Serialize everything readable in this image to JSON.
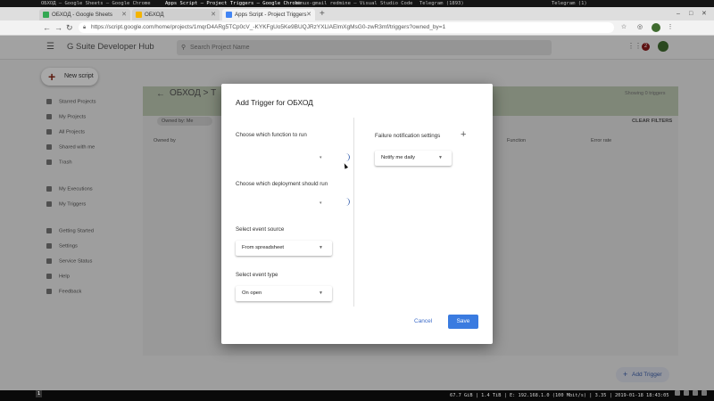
{
  "wm_bar": {
    "titles": [
      "ОБХОД – Google Sheets – Google Chrome",
      "Apps Script – Project Triggers – Google Chrome",
      "linux-gmail redmine – Visual Studio Code",
      "Telegram (1893)",
      "Telegram (1)"
    ],
    "active_index": 1
  },
  "tabs": [
    {
      "label": "ОБХОД - Google Sheets",
      "color": "#34a853"
    },
    {
      "label": "ОБХОД",
      "color": "#f4b400"
    },
    {
      "label": "Apps Script - Project Triggers",
      "color": "#4285f4"
    }
  ],
  "url": "https://script.google.com/home/projects/1mqrD4ARg5TCp0cV_-KYKFgUo5Ke9BUQJRzYXLlAElmXgMsG0-zwR3mf/triggers?owned_by=1",
  "hub": {
    "brand": "G Suite Developer Hub",
    "search_placeholder": "Search Project Name",
    "notification_count": "2",
    "new_script": "New script",
    "nav": [
      "Starred Projects",
      "My Projects",
      "All Projects",
      "Shared with me",
      "Trash",
      "My Executions",
      "My Triggers",
      "Getting Started",
      "Settings",
      "Service Status",
      "Help",
      "Feedback"
    ],
    "project_title": "ОБХОД  >  T",
    "showing": "Showing 0 triggers",
    "filter_chip": "Owned by: Me",
    "clear_filters": "CLEAR FILTERS",
    "columns": [
      "Owned by",
      "Function",
      "Error rate"
    ],
    "add_trigger": "Add Trigger"
  },
  "dialog": {
    "title": "Add Trigger for ОБХОД",
    "function_label": "Choose which function to run",
    "deployment_label": "Choose which deployment should run",
    "event_source_label": "Select event source",
    "event_source_value": "From spreadsheet",
    "event_type_label": "Select event type",
    "event_type_value": "On open",
    "failure_label": "Failure notification settings",
    "failure_value": "Notify me daily",
    "cancel": "Cancel",
    "save": "Save"
  },
  "statusbar": {
    "workspace": "1",
    "metrics": "67.7 GiB | 1.4 TiB | E: 192.168.1.0 (100 Mbit/s) | 3.35 | 2019-01-18 18:43:05"
  },
  "colors": {
    "accent": "#3a7be0",
    "link": "#3c6bc9",
    "spinner": "#4a6fb5"
  }
}
